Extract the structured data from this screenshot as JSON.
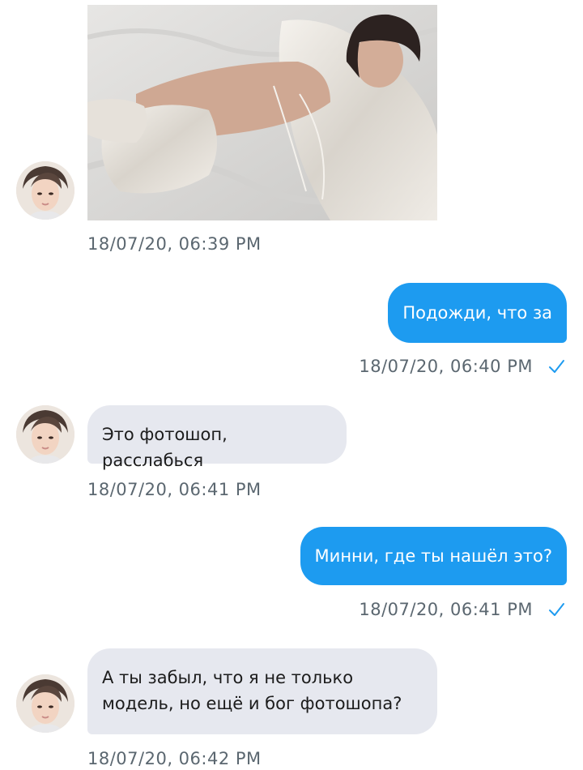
{
  "messages": [
    {
      "direction": "in",
      "kind": "image",
      "image_desc": "photo",
      "timestamp": "18/07/20, 06:39 PM"
    },
    {
      "direction": "out",
      "text": "Подожди, что за",
      "timestamp": "18/07/20, 06:40 PM",
      "read_icon": "check-icon"
    },
    {
      "direction": "in",
      "text": "Это фотошоп, расслабься",
      "timestamp": "18/07/20, 06:41 PM"
    },
    {
      "direction": "out",
      "text": "Минни, где ты нашёл это?",
      "timestamp": "18/07/20, 06:41 PM",
      "read_icon": "check-icon"
    },
    {
      "direction": "in",
      "text": "А ты забыл, что я не только\nмодель, но ещё и бог фотошопа?",
      "timestamp": "18/07/20, 06:42 PM"
    }
  ],
  "colors": {
    "outgoing_bubble": "#1d9bf0",
    "incoming_bubble": "#e6e8ef",
    "timestamp": "#5b6770",
    "check": "#1d9bf0"
  }
}
